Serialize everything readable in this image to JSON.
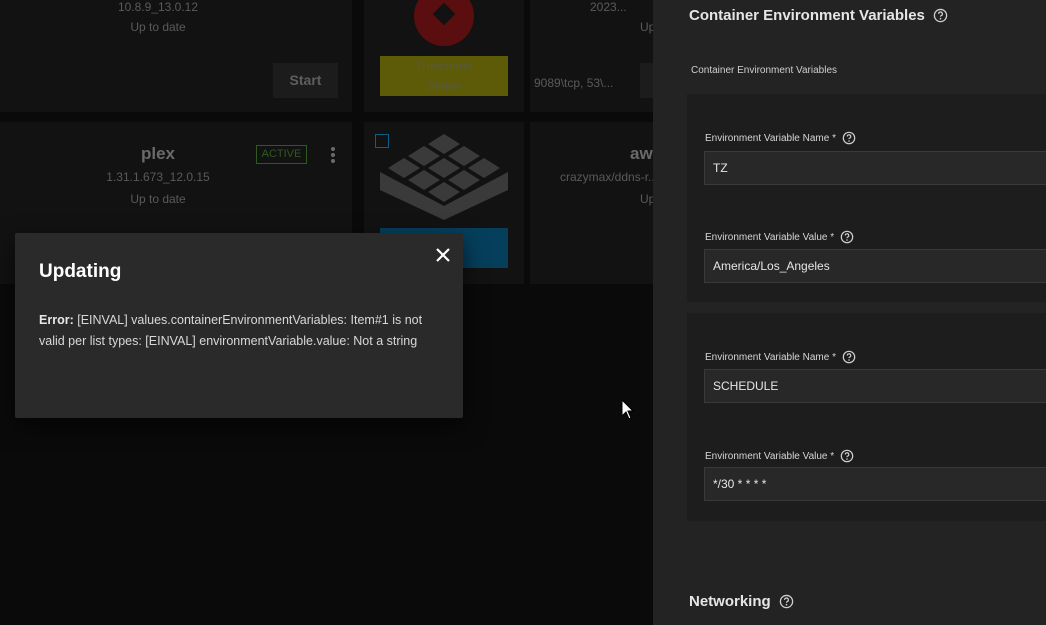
{
  "background": {
    "cards": [
      {
        "version": "10.8.9_13.0.12",
        "status": "Up to date",
        "start_label": "Start"
      },
      {
        "tag1": "Truecharts",
        "tag2": "Stable"
      },
      {
        "version": "2023...",
        "status": "Up...",
        "ports": "9089\\tcp, 53\\..."
      },
      {
        "name": "plex",
        "badge": "ACTIVE",
        "version": "1.31.1.673_12.0.15",
        "status": "Up to date"
      },
      {
        "name": "aw...",
        "version": "crazymax/ddns-r...",
        "status": "Up..."
      }
    ]
  },
  "dialog": {
    "title": "Updating",
    "error_prefix": "Error:",
    "error_message": "[EINVAL] values.containerEnvironmentVariables: Item#1 is not valid per list types: [EINVAL] environmentVariable.value: Not a string"
  },
  "panel": {
    "section_title": "Container Environment Variables",
    "sub_label": "Container Environment Variables",
    "groups": [
      {
        "name_label": "Environment Variable Name",
        "name_value": "TZ",
        "value_label": "Environment Variable Value",
        "value_value": "America/Los_Angeles"
      },
      {
        "name_label": "Environment Variable Name",
        "name_value": "SCHEDULE",
        "value_label": "Environment Variable Value",
        "value_value": "*/30 * * * *"
      }
    ],
    "required_marker": "*",
    "networking_title": "Networking"
  },
  "colors": {
    "panel_bg": "#232323",
    "dialog_bg": "#2a2a2a",
    "truecharts_tag": "#5d5a08",
    "active_badge": "#2f5a1f"
  }
}
